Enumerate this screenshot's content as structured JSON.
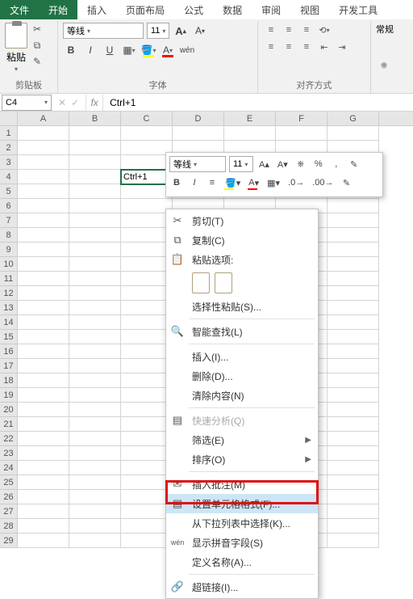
{
  "tabs": {
    "file": "文件",
    "home": "开始",
    "insert": "插入",
    "layout": "页面布局",
    "formulas": "公式",
    "data": "数据",
    "review": "审阅",
    "view": "视图",
    "dev": "开发工具"
  },
  "ribbon": {
    "clipboard": {
      "label": "剪贴板",
      "paste": "粘贴"
    },
    "font": {
      "label": "字体",
      "name": "等线",
      "size": "11",
      "bold": "B",
      "italic": "I",
      "underline": "U",
      "wen": "wén"
    },
    "align": {
      "label": "对齐方式"
    },
    "number": {
      "label": "常规"
    }
  },
  "namebox": "C4",
  "formula": "Ctrl+1",
  "cols": [
    "A",
    "B",
    "C",
    "D",
    "E",
    "F",
    "G"
  ],
  "rows": 29,
  "active_cell": "Ctrl+1",
  "mini": {
    "font": "等线",
    "size": "11",
    "bold": "B",
    "italic": "I",
    "pct": "%"
  },
  "ctx": {
    "cut": "剪切(T)",
    "copy": "复制(C)",
    "paste_opts": "粘贴选项:",
    "paste_special": "选择性粘贴(S)...",
    "smart_lookup": "智能查找(L)",
    "insert": "插入(I)...",
    "delete": "删除(D)...",
    "clear": "清除内容(N)",
    "quick": "快速分析(Q)",
    "filter": "筛选(E)",
    "sort": "排序(O)",
    "comment": "插入批注(M)",
    "format": "设置单元格格式(F)...",
    "dropdown": "从下拉列表中选择(K)...",
    "pinyin": "显示拼音字段(S)",
    "name": "定义名称(A)...",
    "link": "超链接(I)..."
  }
}
